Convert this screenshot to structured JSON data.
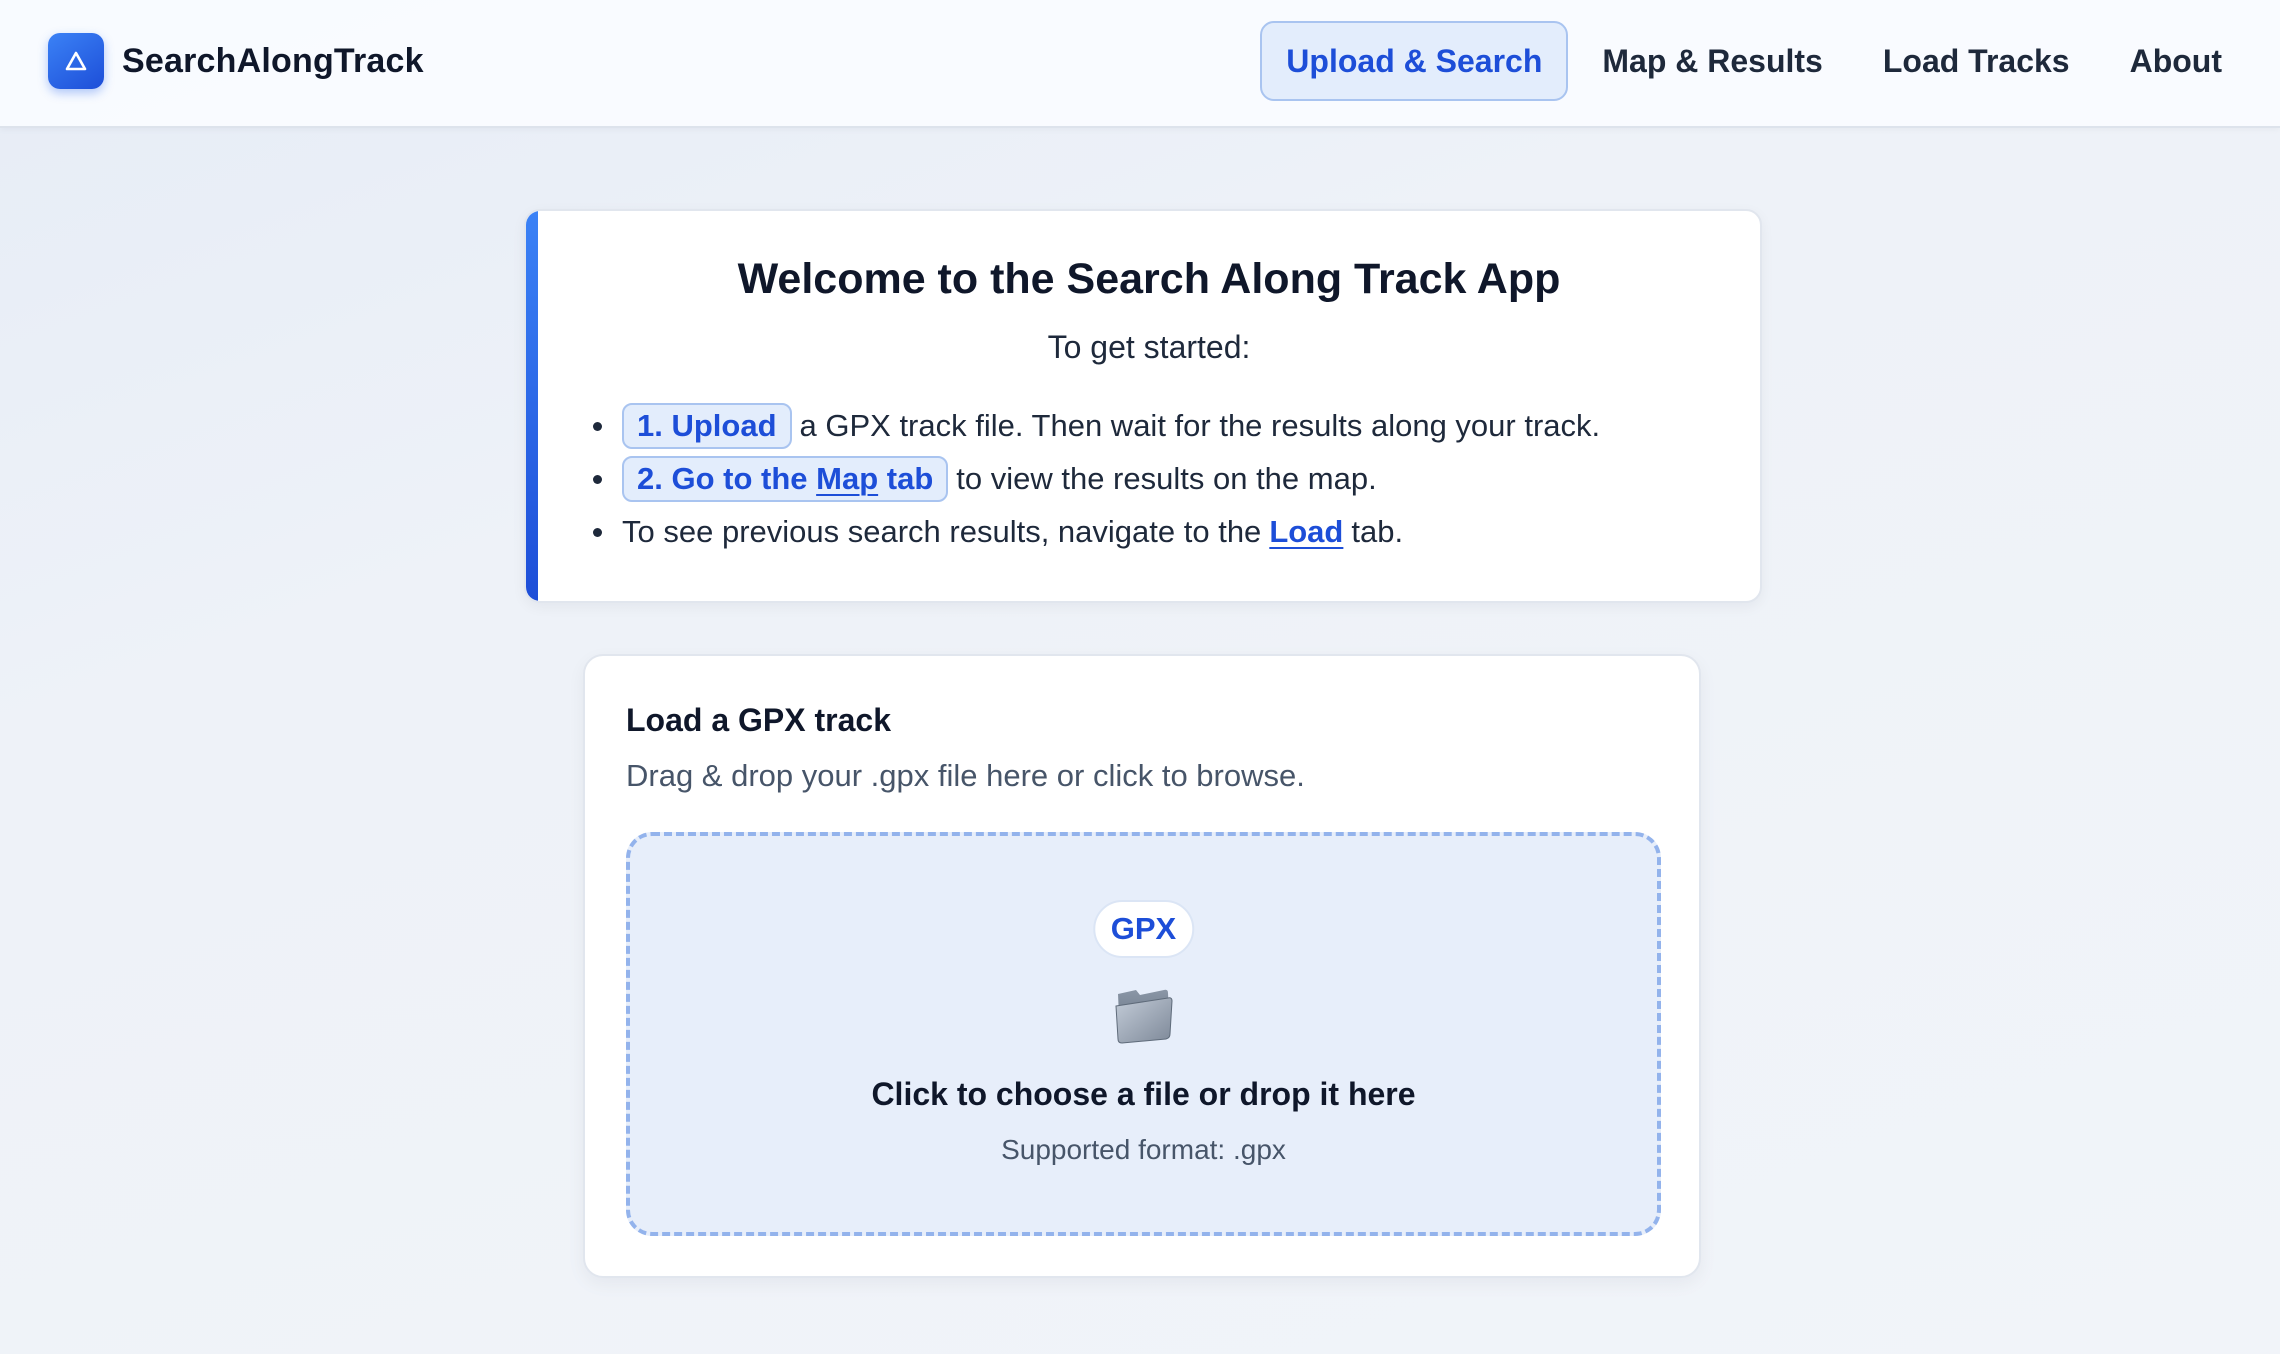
{
  "header": {
    "brand_name": "SearchAlongTrack",
    "brand_icon": "triangle-logo-icon",
    "nav": [
      {
        "label": "Upload & Search",
        "active": true
      },
      {
        "label": "Map & Results",
        "active": false
      },
      {
        "label": "Load Tracks",
        "active": false
      },
      {
        "label": "About",
        "active": false
      }
    ]
  },
  "welcome": {
    "title": "Welcome to the Search Along Track App",
    "subtitle": "To get started:",
    "step1": {
      "pill": "1. Upload",
      "text": "a GPX track file. Then wait for the results along your track."
    },
    "step2": {
      "pill_prefix": "2. Go to the",
      "pill_link": "Map",
      "pill_suffix": "tab",
      "text": "to view the results on the map."
    },
    "step3": {
      "text_before": "To see previous search results, navigate to the",
      "link": "Load",
      "text_after": "tab."
    }
  },
  "upload": {
    "title": "Load a GPX track",
    "description": "Drag & drop your .gpx file here or click to browse.",
    "badge": "GPX",
    "drop_icon": "folder-icon",
    "drop_main": "Click to choose a file or drop it here",
    "drop_sub": "Supported format: .gpx"
  },
  "colors": {
    "accent": "#1d4ed8",
    "accent_light": "#e3edfc",
    "dropzone_bg": "#e7eefa",
    "dropzone_border": "#93b3ec",
    "text_dark": "#0f172a",
    "text_muted": "#475569"
  }
}
